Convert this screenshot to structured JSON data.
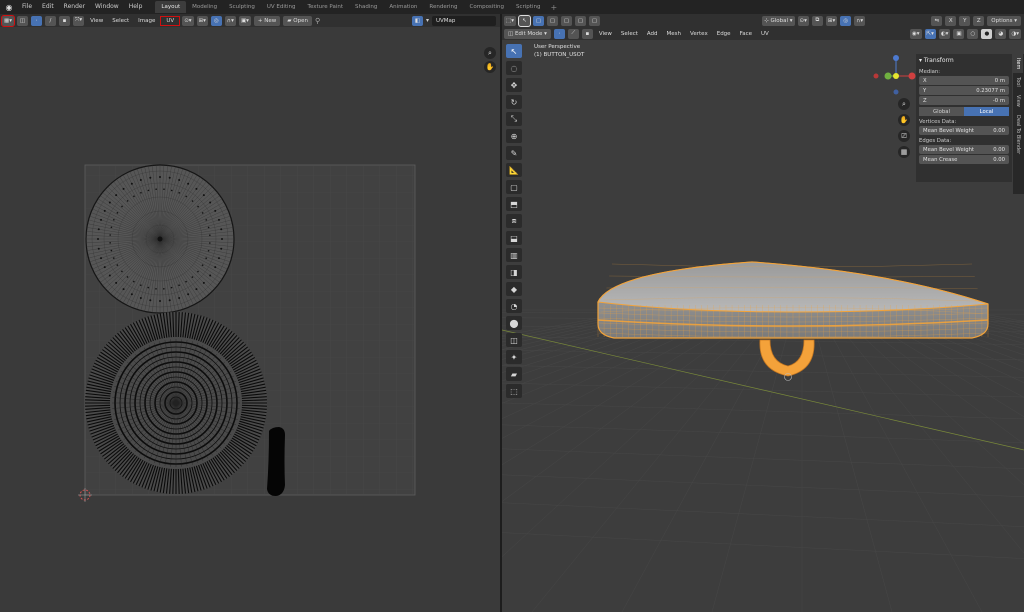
{
  "menubar": {
    "items": [
      "File",
      "Edit",
      "Render",
      "Window",
      "Help"
    ],
    "workspaces": [
      "Layout",
      "Modeling",
      "Sculpting",
      "UV Editing",
      "Texture Paint",
      "Shading",
      "Animation",
      "Rendering",
      "Compositing",
      "Scripting"
    ],
    "active_workspace": "Layout",
    "add_tab": "+"
  },
  "uv_editor": {
    "menus": [
      "View",
      "Select",
      "Image",
      "UV"
    ],
    "new_label": "New",
    "open_label": "Open",
    "uvmap": "UVMap"
  },
  "viewport": {
    "mode": "Edit Mode",
    "menus": [
      "View",
      "Select",
      "Add",
      "Mesh",
      "Vertex",
      "Edge",
      "Face",
      "UV"
    ],
    "orientation": "Global",
    "axes": [
      "X",
      "Y",
      "Z"
    ],
    "options_label": "Options",
    "perspective_label": "User Perspective",
    "object_label": "(1) BUTTON_USOT"
  },
  "npanel": {
    "title": "Transform",
    "median_label": "Median:",
    "fields": [
      {
        "label": "X",
        "value": "0 m"
      },
      {
        "label": "Y",
        "value": "0.23077 m"
      },
      {
        "label": "Z",
        "value": "-0 m"
      }
    ],
    "global_label": "Global",
    "local_label": "Local",
    "vertices_label": "Vertices Data:",
    "bevel_vert": {
      "label": "Mean Bevel Weight",
      "value": "0.00"
    },
    "edges_label": "Edges Data:",
    "bevel_edge": {
      "label": "Mean Bevel Weight",
      "value": "0.00"
    },
    "crease": {
      "label": "Mean Crease",
      "value": "0.00"
    },
    "tabs": [
      "Item",
      "Tool",
      "View",
      "Deal To Blender"
    ]
  },
  "colors": {
    "accent": "#4772b3",
    "selection": "#f2a33a",
    "highlight_box": "#d01010"
  }
}
